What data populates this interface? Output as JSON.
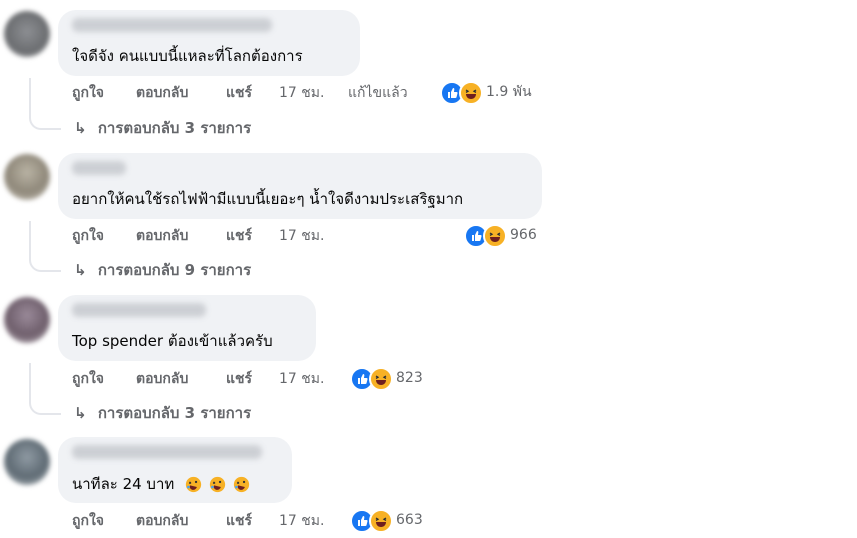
{
  "comments": [
    {
      "text": "ใจดีจัง คนแบบนี้แหละที่โลกต้องการ",
      "like": "ถูกใจ",
      "reply": "ตอบกลับ",
      "share": "แชร์",
      "time": "17 ชม.",
      "edited": "แก้ไขแล้ว",
      "reaction_icons": [
        "like-icon",
        "haha-icon"
      ],
      "reaction_count": "1.9 พัน",
      "replies_label": "การตอบกลับ 3 รายการ"
    },
    {
      "text": "อยากให้คนใช้รถไฟฟ้ามีแบบนี้เยอะๆ น้ำใจดีงามประเสริฐมาก",
      "like": "ถูกใจ",
      "reply": "ตอบกลับ",
      "share": "แชร์",
      "time": "17 ชม.",
      "reaction_icons": [
        "like-icon",
        "haha-icon"
      ],
      "reaction_count": "966",
      "replies_label": "การตอบกลับ 9 รายการ"
    },
    {
      "text": "Top spender ต้องเข้าแล้วครับ",
      "like": "ถูกใจ",
      "reply": "ตอบกลับ",
      "share": "แชร์",
      "time": "17 ชม.",
      "reaction_icons": [
        "like-icon",
        "haha-icon"
      ],
      "reaction_count": "823",
      "replies_label": "การตอบกลับ 3 รายการ"
    },
    {
      "text": "นาทีละ 24 บาท",
      "text_emojis": [
        "rolling-laughing-emoji",
        "rolling-laughing-emoji",
        "rolling-laughing-emoji"
      ],
      "like": "ถูกใจ",
      "reply": "ตอบกลับ",
      "share": "แชร์",
      "time": "17 ชม.",
      "reaction_icons": [
        "like-icon",
        "haha-icon"
      ],
      "reaction_count": "663"
    }
  ],
  "icons": {
    "reply_arrow": "↳"
  },
  "colors": {
    "like": "#1877f2",
    "haha": "#f7b125",
    "bubble": "#f0f2f5",
    "secondary_text": "#65676b"
  }
}
